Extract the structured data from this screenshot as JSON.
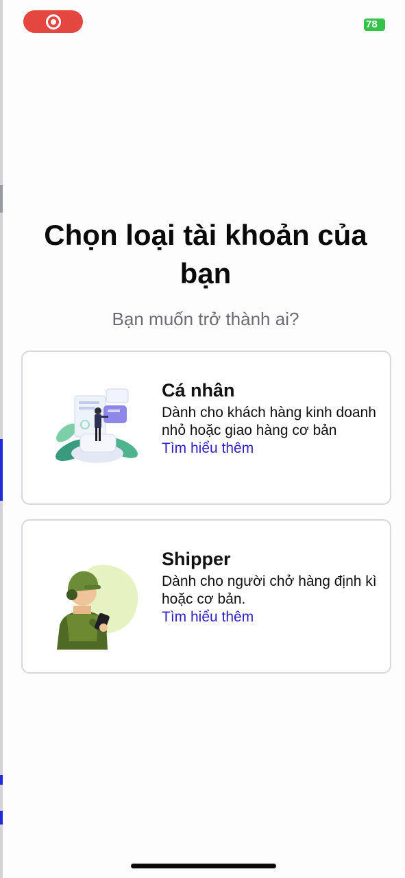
{
  "status_bar": {
    "battery_level": "78"
  },
  "header": {
    "title": "Chọn loại tài khoản của bạn",
    "subtitle": "Bạn muốn trở thành ai?"
  },
  "account_types": [
    {
      "title": "Cá nhân",
      "description": "Dành cho khách hàng kinh doanh nhỏ hoặc giao hàng cơ bản",
      "link": "Tìm hiểu thêm",
      "icon": "business-person-illustration"
    },
    {
      "title": "Shipper",
      "description": "Dành cho người chở hàng định kì hoặc cơ bản.",
      "link": "Tìm hiểu thêm",
      "icon": "shipper-illustration"
    }
  ],
  "colors": {
    "accent_link": "#2d1fc4",
    "record_pill": "#e4473f",
    "battery": "#35c24a",
    "card_border": "#d7d7de",
    "subtitle": "#6b6b73"
  }
}
